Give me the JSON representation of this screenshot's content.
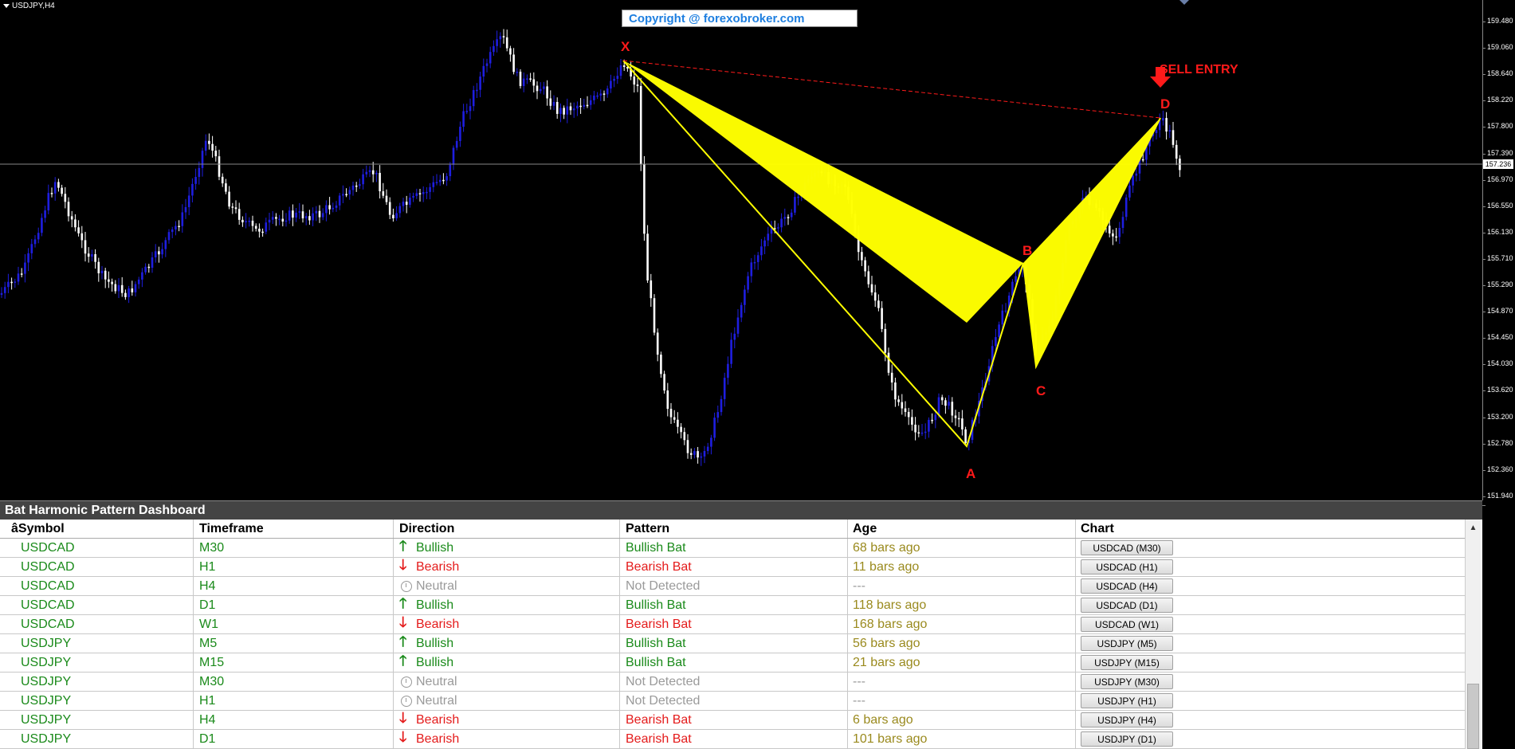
{
  "chart": {
    "symbol_label": "USDJPY,H4",
    "copyright": "Copyright @ forexobroker.com",
    "current_price": "157.236",
    "price_ticks": [
      "159.480",
      "159.060",
      "158.640",
      "158.220",
      "157.800",
      "157.390",
      "156.970",
      "156.550",
      "156.130",
      "155.710",
      "155.290",
      "154.870",
      "154.450",
      "154.030",
      "153.620",
      "153.200",
      "152.780",
      "152.360",
      "151.940"
    ],
    "points": {
      "x": "X",
      "a": "A",
      "b": "B",
      "c": "C",
      "d": "D"
    },
    "sell_label": "SELL ENTRY",
    "colors": {
      "bull": "#1e1ee0",
      "bear": "#ffffff",
      "pattern": "#ffff00",
      "label": "#ff1a1a"
    }
  },
  "panel": {
    "title": "Bat Harmonic Pattern Dashboard",
    "scroll_zero": "0",
    "headers": {
      "symbol": "âSymbol",
      "timeframe": "Timeframe",
      "direction": "Direction",
      "pattern": "Pattern",
      "age": "Age",
      "chart": "Chart"
    },
    "rows": [
      {
        "symbol": "USDCAD",
        "tf": "M30",
        "dir": "Bullish",
        "pattern": "Bullish Bat",
        "age": "68 bars ago",
        "chart": "USDCAD (M30)"
      },
      {
        "symbol": "USDCAD",
        "tf": "H1",
        "dir": "Bearish",
        "pattern": "Bearish Bat",
        "age": "11 bars ago",
        "chart": "USDCAD (H1)"
      },
      {
        "symbol": "USDCAD",
        "tf": "H4",
        "dir": "Neutral",
        "pattern": "Not Detected",
        "age": "---",
        "chart": "USDCAD (H4)"
      },
      {
        "symbol": "USDCAD",
        "tf": "D1",
        "dir": "Bullish",
        "pattern": "Bullish Bat",
        "age": "118 bars ago",
        "chart": "USDCAD (D1)"
      },
      {
        "symbol": "USDCAD",
        "tf": "W1",
        "dir": "Bearish",
        "pattern": "Bearish Bat",
        "age": "168 bars ago",
        "chart": "USDCAD (W1)"
      },
      {
        "symbol": "USDJPY",
        "tf": "M5",
        "dir": "Bullish",
        "pattern": "Bullish Bat",
        "age": "56 bars ago",
        "chart": "USDJPY (M5)"
      },
      {
        "symbol": "USDJPY",
        "tf": "M15",
        "dir": "Bullish",
        "pattern": "Bullish Bat",
        "age": "21 bars ago",
        "chart": "USDJPY (M15)"
      },
      {
        "symbol": "USDJPY",
        "tf": "M30",
        "dir": "Neutral",
        "pattern": "Not Detected",
        "age": "---",
        "chart": "USDJPY (M30)"
      },
      {
        "symbol": "USDJPY",
        "tf": "H1",
        "dir": "Neutral",
        "pattern": "Not Detected",
        "age": "---",
        "chart": "USDJPY (H1)"
      },
      {
        "symbol": "USDJPY",
        "tf": "H4",
        "dir": "Bearish",
        "pattern": "Bearish Bat",
        "age": "6 bars ago",
        "chart": "USDJPY (H4)"
      },
      {
        "symbol": "USDJPY",
        "tf": "D1",
        "dir": "Bearish",
        "pattern": "Bearish Bat",
        "age": "101 bars ago",
        "chart": "USDJPY (D1)"
      }
    ]
  }
}
